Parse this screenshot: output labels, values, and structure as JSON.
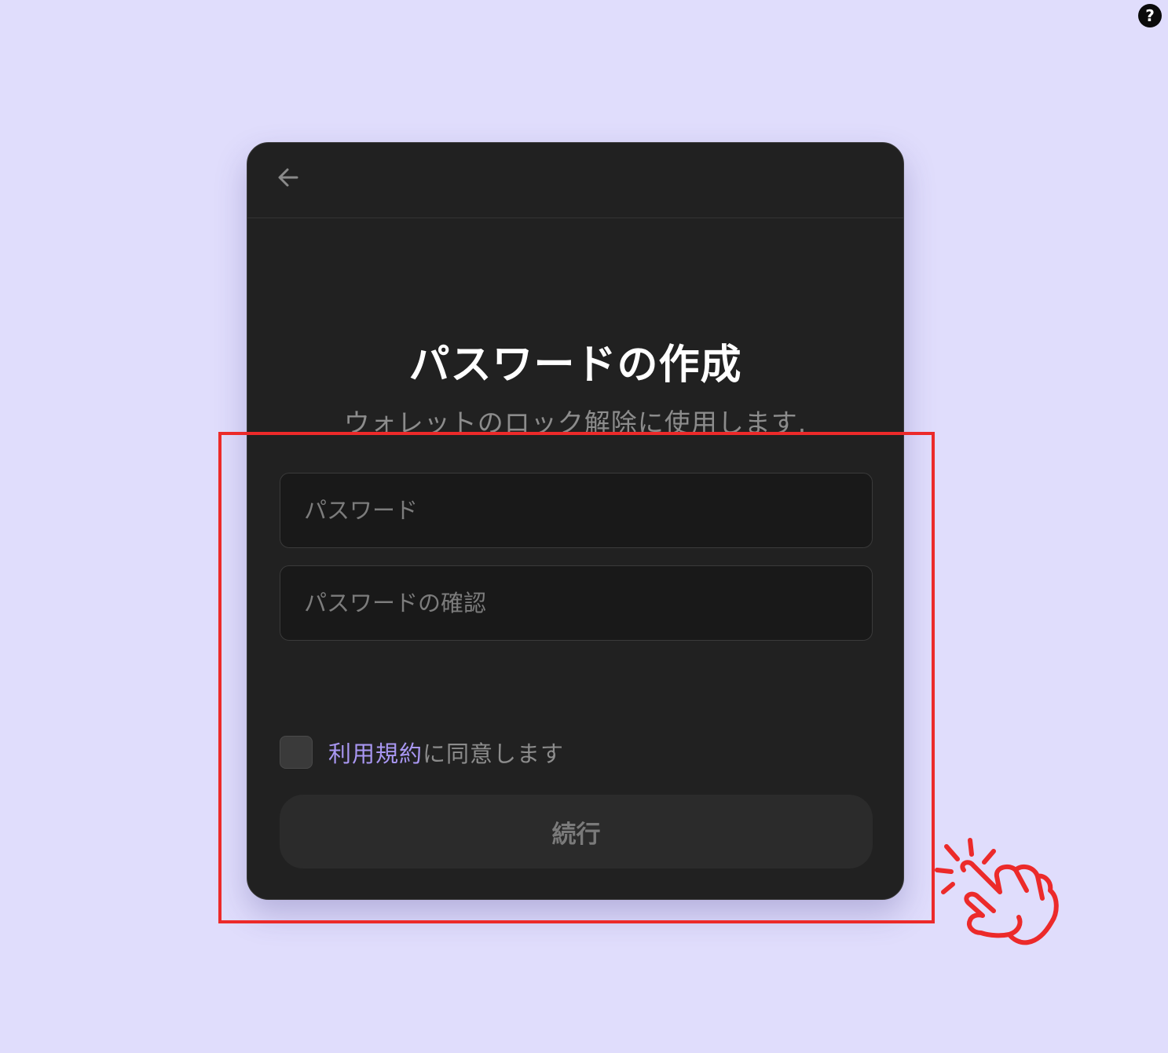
{
  "help": {
    "icon": "question-circle-icon",
    "glyph": "?"
  },
  "card": {
    "back_icon": "arrow-left-icon",
    "title": "パスワードの作成",
    "subtitle": "ウォレットのロック解除に使用します.",
    "password_field": {
      "placeholder": "パスワード",
      "value": ""
    },
    "confirm_field": {
      "placeholder": "パスワードの確認",
      "value": ""
    },
    "terms": {
      "checked": false,
      "link_text": "利用規約",
      "suffix_text": "に同意します"
    },
    "continue_label": "続行"
  },
  "annotation": {
    "highlight_color": "#ec2a2a",
    "pointer_icon": "tapping-hand-icon"
  },
  "colors": {
    "background": "#e0ddfc",
    "card": "#212121",
    "accent_link": "#a997f2"
  }
}
